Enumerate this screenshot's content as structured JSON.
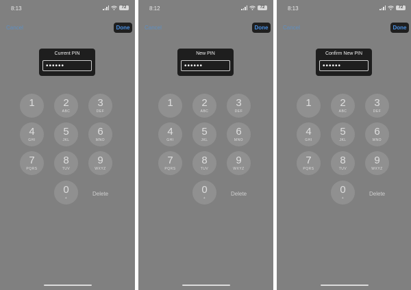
{
  "screens": [
    {
      "time": "8:13",
      "battery": "72",
      "cancel": "Cancel",
      "done": "Done",
      "pin_title": "Current PIN",
      "pin_value": "••••••",
      "delete": "Delete"
    },
    {
      "time": "8:12",
      "battery": "72",
      "cancel": "Cancel",
      "done": "Done",
      "pin_title": "New PIN",
      "pin_value": "••••••",
      "delete": "Delete"
    },
    {
      "time": "8:13",
      "battery": "72",
      "cancel": "Cancel",
      "done": "Done",
      "pin_title": "Confirm New PIN",
      "pin_value": "••••••",
      "delete": "Delete"
    }
  ],
  "keypad": [
    {
      "digit": "1",
      "letters": ""
    },
    {
      "digit": "2",
      "letters": "ABC"
    },
    {
      "digit": "3",
      "letters": "DEF"
    },
    {
      "digit": "4",
      "letters": "GHI"
    },
    {
      "digit": "5",
      "letters": "JKL"
    },
    {
      "digit": "6",
      "letters": "MNO"
    },
    {
      "digit": "7",
      "letters": "PQRS"
    },
    {
      "digit": "8",
      "letters": "TUV"
    },
    {
      "digit": "9",
      "letters": "WXYZ"
    },
    {
      "digit": "0",
      "letters": "+"
    }
  ],
  "colors": {
    "panel_bg": "#808080",
    "done_text": "#4a90e2",
    "cancel_text": "#5e8fc2"
  },
  "icons": [
    "signal-icon",
    "wifi-icon",
    "battery-icon"
  ]
}
